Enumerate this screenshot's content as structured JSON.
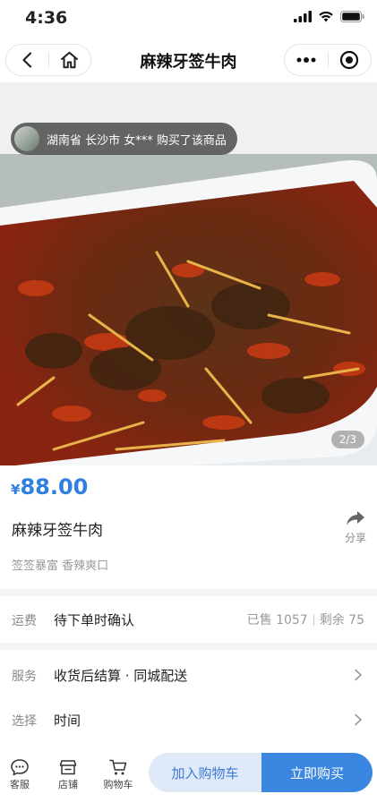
{
  "status_bar": {
    "time": "4:36"
  },
  "nav": {
    "title": "麻辣牙签牛肉"
  },
  "gallery": {
    "buyer_notice": "湖南省 长沙市 女*** 购买了该商品",
    "pager": "2/3"
  },
  "product": {
    "currency": "¥",
    "price": "88.00",
    "name": "麻辣牙签牛肉",
    "share_label": "分享",
    "tagline": "签签暴富 香辣爽口"
  },
  "shipping": {
    "label": "运费",
    "value": "待下单时确认",
    "sold": "已售 1057",
    "remaining": "剩余 75"
  },
  "service": {
    "label": "服务",
    "value": "收货后结算 · 同城配送",
    "select_label": "选择",
    "select_value": "时间"
  },
  "bottom_bar": {
    "service_label": "客服",
    "store_label": "店铺",
    "cart_label": "购物车",
    "add_to_cart": "加入购物车",
    "buy_now": "立即购买"
  },
  "colors": {
    "accent": "#3a86e0",
    "price": "#2f7fe0"
  }
}
